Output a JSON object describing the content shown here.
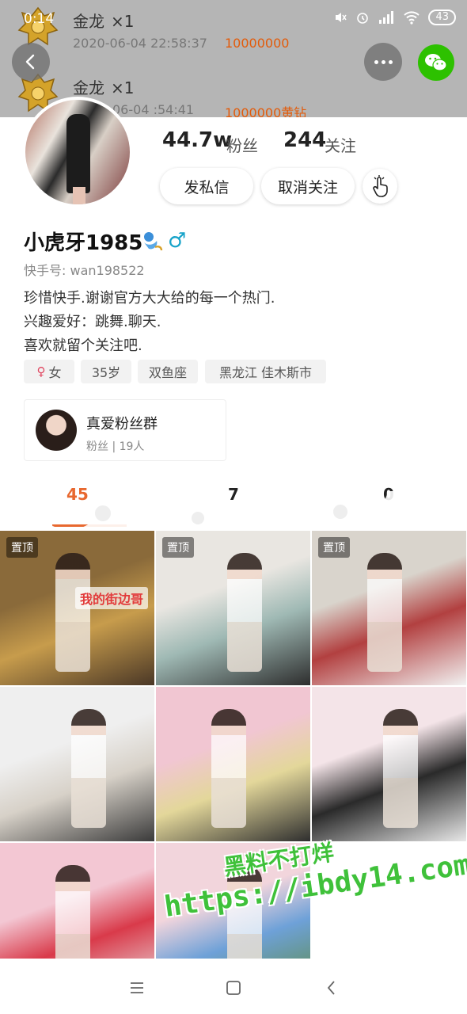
{
  "status_bar": {
    "time": "0:14",
    "battery": "43"
  },
  "gift_feed": [
    {
      "name": "金龙",
      "count": "×1",
      "time": "2020-06-04 22:58:37",
      "amount": "10000000"
    },
    {
      "name": "金龙",
      "count": "×1",
      "time": "06-04  :54:41",
      "amount": "1000000黄钻"
    }
  ],
  "profile": {
    "followers_count": "44.7w",
    "followers_label": "粉丝",
    "following_count": "244",
    "following_label": "关注",
    "message_button": "发私信",
    "unfollow_button": "取消关注",
    "name": "小虎牙1985",
    "gender_symbol": "♂",
    "kwai_id": "快手号: wan198522",
    "bio": [
      "珍惜快手.谢谢官方大大给的每一个热门.",
      "兴趣爱好：跳舞.聊天.",
      "喜欢就留个关注吧."
    ],
    "tags": [
      "女",
      "35岁",
      "双鱼座",
      "黑龙江 佳木斯市"
    ]
  },
  "fan_group": {
    "title": "真爱粉丝群",
    "subtitle": "粉丝 | 19人"
  },
  "tabs": [
    {
      "label": "45",
      "active": true
    },
    {
      "label": "7",
      "active": false
    },
    {
      "label": "0",
      "active": false
    }
  ],
  "grid": {
    "pin_label": "置顶",
    "overlay_text": "我的街边哥",
    "items": [
      {
        "pinned": true,
        "palette": [
          "#8a6a3a",
          "#c79c4c",
          "#4a3726"
        ]
      },
      {
        "pinned": true,
        "palette": [
          "#e9e6e1",
          "#9fb9b4",
          "#2d2d2d"
        ]
      },
      {
        "pinned": true,
        "palette": [
          "#d9d4cc",
          "#b24040",
          "#f2f2f2"
        ]
      },
      {
        "pinned": false,
        "palette": [
          "#efefef",
          "#d7d1c8",
          "#3a3a3a"
        ]
      },
      {
        "pinned": false,
        "palette": [
          "#f1c6d2",
          "#e3d79a",
          "#2e2e2e"
        ]
      },
      {
        "pinned": false,
        "palette": [
          "#f4e4e8",
          "#2a2a2a",
          "#e8e8e8"
        ]
      },
      {
        "pinned": false,
        "palette": [
          "#f3c7d3",
          "#d93a4a",
          "#e9e9e9"
        ]
      },
      {
        "pinned": false,
        "palette": [
          "#f2d5dc",
          "#6ea1d8",
          "#5c8a3c"
        ]
      }
    ]
  },
  "watermark": {
    "line1": "黑料不打烊",
    "line2": "https://ibdy14.com"
  },
  "colors": {
    "accent": "#e8682f",
    "gift_amount": "#e35b0a",
    "wechat": "#2dc100",
    "watermark": "#3fc13a"
  }
}
